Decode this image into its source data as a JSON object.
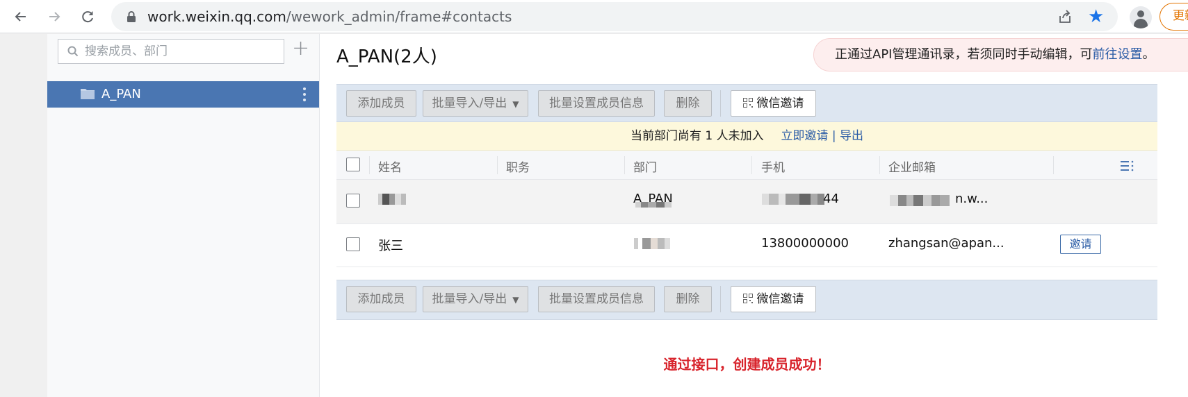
{
  "browser": {
    "url_host": "work.weixin.qq.com",
    "url_path": "/wework_admin/frame#contacts",
    "update_label": "更新"
  },
  "sidebar": {
    "search_placeholder": "搜索成员、部门",
    "add_symbol": "+",
    "dept_label": "A_PAN"
  },
  "main": {
    "dept_title": "A_PAN(2人)",
    "api_banner": {
      "text": "正通过API管理通讯录，若须同时手动编辑，可",
      "link": "前往设置",
      "suffix": "。"
    },
    "toolbar": {
      "add_member": "添加成员",
      "import_export": "批量导入/导出",
      "caret": "▼",
      "batch_set": "批量设置成员信息",
      "delete": "删除",
      "wechat_invite": "微信邀请"
    },
    "notice": {
      "text": "当前部门尚有 1 人未加入",
      "invite_now": "立即邀请",
      "divider": "|",
      "export": "导出"
    },
    "table": {
      "headers": {
        "name": "姓名",
        "position": "职务",
        "department": "部门",
        "mobile": "手机",
        "email": "企业邮箱"
      },
      "rows": [
        {
          "name": "",
          "position": "",
          "department": "A_PAN",
          "mobile": "44",
          "email": "n.w..."
        },
        {
          "name": "张三",
          "position": "",
          "department": "",
          "mobile": "13800000000",
          "email": "zhangsan@apan...",
          "action": "邀请"
        }
      ]
    },
    "success_message": "通过接口，创建成员成功！"
  },
  "colors": {
    "accent": "#4a76b2",
    "link": "#2b5ca6",
    "success_text": "#d8242c",
    "toolbar_bg": "#dde6f1",
    "notice_bg": "#fdf8dc",
    "banner_bg": "#fdeeee",
    "update_orange": "#e37400"
  },
  "icons": [
    "back-arrow-icon",
    "forward-arrow-icon",
    "reload-icon",
    "lock-icon",
    "share-icon",
    "star-icon",
    "profile-icon",
    "search-icon",
    "folder-icon",
    "more-vertical-icon",
    "qr-code-icon",
    "column-settings-icon"
  ]
}
